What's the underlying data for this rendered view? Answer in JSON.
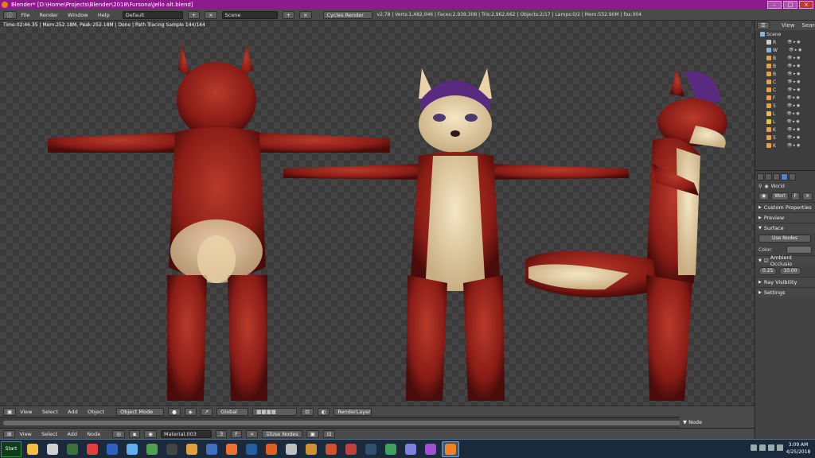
{
  "window": {
    "title": "Blender* [D:\\Home\\Projects\\Blender\\2018\\Fursona\\Jello alt.blend]"
  },
  "info_header": {
    "menus": [
      "File",
      "Render",
      "Window",
      "Help"
    ],
    "layout": "Default",
    "scene": "Scene",
    "engine": "Cycles Render",
    "stats": "v2.78 | Verts:1,482,046 | Faces:2,939,308 | Tris:2,962,662 | Objects:2/17 | Lamps:0/2 | Mem:552.90M | fox.004"
  },
  "viewport": {
    "render_info": "Time:02:46.35 | Mem:252.18M, Peak:252.18M | Done | Path Tracing Sample 144/144"
  },
  "viewport_header": {
    "menus": [
      "View",
      "Select",
      "Add",
      "Object"
    ],
    "mode": "Object Mode",
    "orientation": "Global",
    "render_layer": "RenderLayer"
  },
  "node_header": {
    "menus": [
      "View",
      "Select",
      "Add",
      "Node"
    ],
    "material": "Material.003",
    "users": "3",
    "fake_user": "F",
    "use_nodes_label": "Use Nodes",
    "panel_label": "Node"
  },
  "outliner": {
    "tabs": [
      "View",
      "Search"
    ],
    "root": "Scene",
    "rows": [
      {
        "label": "R",
        "color": "#cfcfcf"
      },
      {
        "label": "W",
        "color": "#8db1d9"
      },
      {
        "label": "B",
        "color": "#e8a040"
      },
      {
        "label": "B",
        "color": "#e8a040"
      },
      {
        "label": "B",
        "color": "#e8a040"
      },
      {
        "label": "C",
        "color": "#e8a040"
      },
      {
        "label": "C",
        "color": "#e8a040"
      },
      {
        "label": "F",
        "color": "#e8a040"
      },
      {
        "label": "S",
        "color": "#e8a040"
      },
      {
        "label": "L",
        "color": "#e8c040"
      },
      {
        "label": "L",
        "color": "#e8c040"
      },
      {
        "label": "K",
        "color": "#e8a040"
      },
      {
        "label": "S",
        "color": "#e8a040"
      },
      {
        "label": "K",
        "color": "#e8a040"
      }
    ]
  },
  "properties": {
    "world_label": "World",
    "world_name": "Worl",
    "world_fake": "F",
    "panels": {
      "custom_properties": "Custom Properties",
      "preview": "Preview",
      "surface": "Surface",
      "ambient_occlusion": "Ambient Occlusio",
      "ray_visibility": "Ray Visibility",
      "settings": "Settings"
    },
    "use_nodes": "Use Nodes",
    "color_label": "Color:",
    "color_value": "#6a6a6a",
    "ao_factor": "0.25",
    "ao_distance": "10.00"
  },
  "taskbar": {
    "start_label": "Start",
    "apps": [
      {
        "name": "explorer-icon",
        "color": "#f0c040"
      },
      {
        "name": "notepad-icon",
        "color": "#d0d0d0"
      },
      {
        "name": "camera-icon",
        "color": "#407040"
      },
      {
        "name": "chrome-icon",
        "color": "#e04040"
      },
      {
        "name": "tool-icon",
        "color": "#3060c0"
      },
      {
        "name": "sketch-icon",
        "color": "#60b0f0"
      },
      {
        "name": "wolf-icon",
        "color": "#50a050"
      },
      {
        "name": "archive-icon",
        "color": "#444444"
      },
      {
        "name": "fl-studio-icon",
        "color": "#e0a040"
      },
      {
        "name": "python-icon",
        "color": "#4070c0"
      },
      {
        "name": "chat-icon",
        "color": "#f07030"
      },
      {
        "name": "psd-icon",
        "color": "#2060a0"
      },
      {
        "name": "media-player-icon",
        "color": "#e06020"
      },
      {
        "name": "mask-icon",
        "color": "#c0c0c0"
      },
      {
        "name": "lion-icon",
        "color": "#d09030"
      },
      {
        "name": "crab-icon",
        "color": "#d05030"
      },
      {
        "name": "paint-icon",
        "color": "#c04040"
      },
      {
        "name": "steam-icon",
        "color": "#305070"
      },
      {
        "name": "mixer-icon",
        "color": "#40a060"
      },
      {
        "name": "floppy-icon",
        "color": "#8080e0"
      },
      {
        "name": "spider-icon",
        "color": "#a050d0"
      },
      {
        "name": "blender-icon",
        "color": "#f08020"
      }
    ],
    "clock_time": "3:09 AM",
    "clock_date": "4/25/2018"
  },
  "figures": {
    "body_color": "#8a1c16",
    "belly_color": "#e8d2a6",
    "hair_color": "#5a2a80"
  }
}
